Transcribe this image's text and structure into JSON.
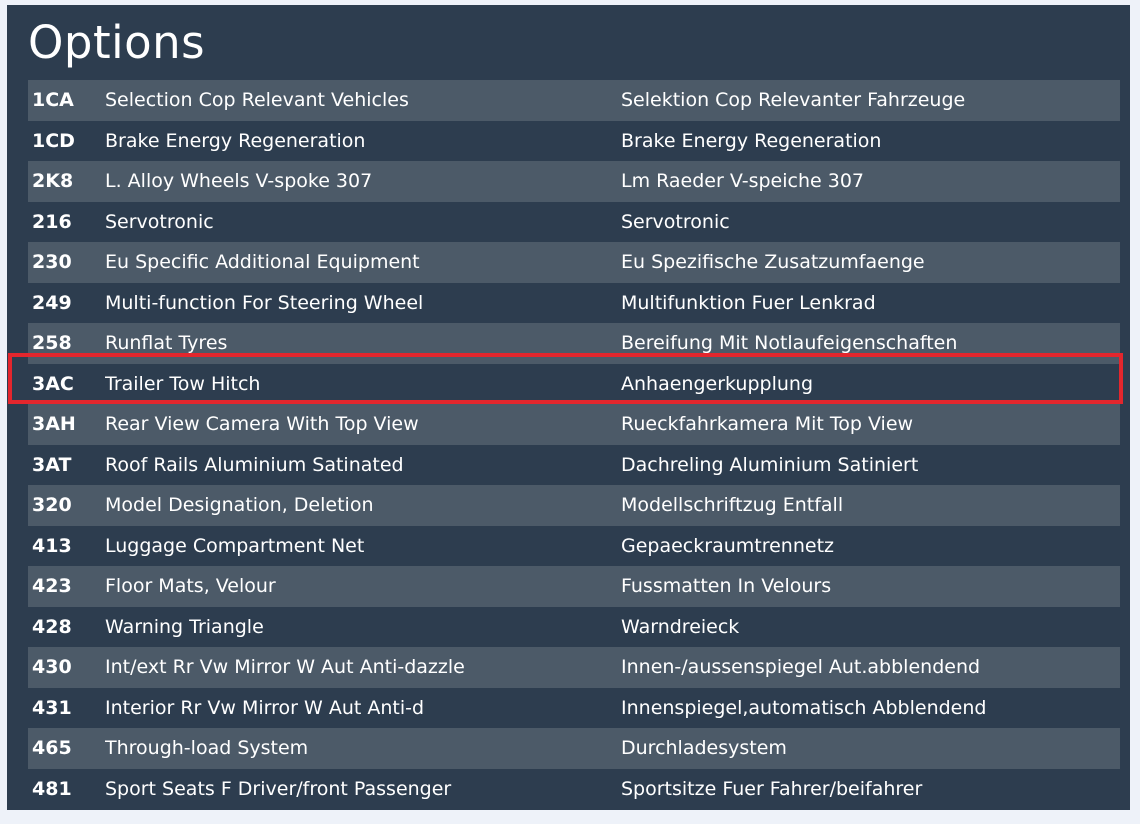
{
  "title": "Options",
  "colors": {
    "background": "#eef2f9",
    "panel": "#2d3d4f",
    "row_alt": "#4c5a68",
    "highlight": "#e3262d"
  },
  "options": [
    {
      "code": "1CA",
      "name_en": "Selection Cop Relevant Vehicles",
      "name_de": "Selektion Cop Relevanter Fahrzeuge"
    },
    {
      "code": "1CD",
      "name_en": "Brake Energy Regeneration",
      "name_de": "Brake Energy Regeneration"
    },
    {
      "code": "2K8",
      "name_en": "L. Alloy Wheels V-spoke 307",
      "name_de": "Lm Raeder V-speiche 307"
    },
    {
      "code": "216",
      "name_en": "Servotronic",
      "name_de": "Servotronic"
    },
    {
      "code": "230",
      "name_en": "Eu Specific Additional Equipment",
      "name_de": "Eu Spezifische Zusatzumfaenge"
    },
    {
      "code": "249",
      "name_en": "Multi-function For Steering Wheel",
      "name_de": "Multifunktion Fuer Lenkrad"
    },
    {
      "code": "258",
      "name_en": "Runflat Tyres",
      "name_de": "Bereifung Mit Notlaufeigenschaften"
    },
    {
      "code": "3AC",
      "name_en": "Trailer Tow Hitch",
      "name_de": "Anhaengerkupplung"
    },
    {
      "code": "3AH",
      "name_en": "Rear View Camera With Top View",
      "name_de": "Rueckfahrkamera Mit Top View"
    },
    {
      "code": "3AT",
      "name_en": "Roof Rails Aluminium Satinated",
      "name_de": "Dachreling Aluminium Satiniert"
    },
    {
      "code": "320",
      "name_en": "Model Designation, Deletion",
      "name_de": "Modellschriftzug Entfall"
    },
    {
      "code": "413",
      "name_en": "Luggage Compartment Net",
      "name_de": "Gepaeckraumtrennetz"
    },
    {
      "code": "423",
      "name_en": "Floor Mats, Velour",
      "name_de": "Fussmatten In Velours"
    },
    {
      "code": "428",
      "name_en": "Warning Triangle",
      "name_de": "Warndreieck"
    },
    {
      "code": "430",
      "name_en": "Int/ext Rr Vw Mirror W Aut Anti-dazzle",
      "name_de": "Innen-/aussenspiegel Aut.abblendend"
    },
    {
      "code": "431",
      "name_en": "Interior Rr Vw Mirror W Aut Anti-d",
      "name_de": "Innenspiegel,automatisch Abblendend"
    },
    {
      "code": "465",
      "name_en": "Through-load System",
      "name_de": "Durchladesystem"
    },
    {
      "code": "481",
      "name_en": "Sport Seats F Driver/front Passenger",
      "name_de": "Sportsitze Fuer Fahrer/beifahrer"
    }
  ]
}
